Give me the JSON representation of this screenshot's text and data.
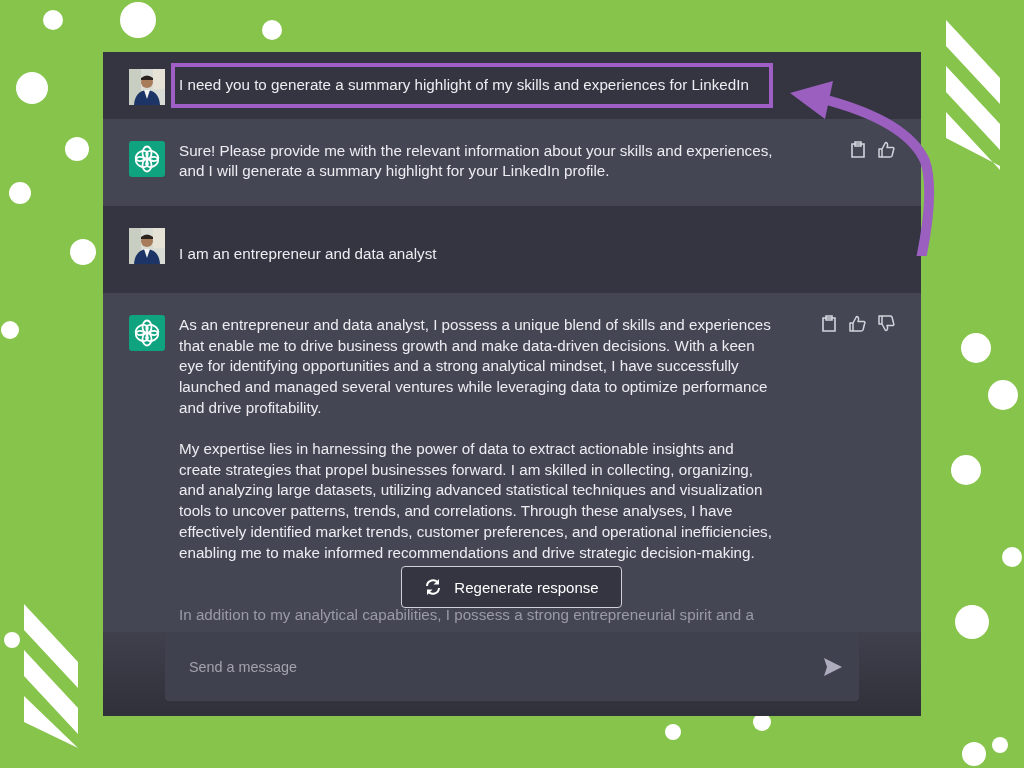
{
  "messages": [
    {
      "kind": "user",
      "highlighted": true,
      "paragraphs": [
        "I need you to generate a summary highlight of my skills and experiences for LinkedIn"
      ]
    },
    {
      "kind": "assistant",
      "dislike_shown": false,
      "paragraphs": [
        "Sure! Please provide me with the relevant information about your skills and experiences, and I will generate a summary highlight for your LinkedIn profile."
      ]
    },
    {
      "kind": "user",
      "highlighted": false,
      "paragraphs": [
        "I am an entrepreneur and data analyst"
      ]
    },
    {
      "kind": "assistant",
      "dislike_shown": true,
      "paragraphs": [
        "As an entrepreneur and data analyst, I possess a unique blend of skills and experiences that enable me to drive business growth and make data-driven decisions. With a keen eye for identifying opportunities and a strong analytical mindset, I have successfully launched and managed several ventures while leveraging data to optimize performance and drive profitability.",
        "My expertise lies in harnessing the power of data to extract actionable insights and create strategies that propel businesses forward. I am skilled in collecting, organizing, and analyzing large datasets, utilizing advanced statistical techniques and visualization tools to uncover patterns, trends, and correlations. Through these analyses, I have effectively identified market trends, customer preferences, and operational inefficiencies, enabling me to make informed recommendations and drive strategic decision-making.",
        "In addition to my analytical capabilities, I possess a strong entrepreneurial spirit and a"
      ]
    }
  ],
  "regenerate_button": "Regenerate response",
  "composer": {
    "placeholder": "Send a message"
  }
}
